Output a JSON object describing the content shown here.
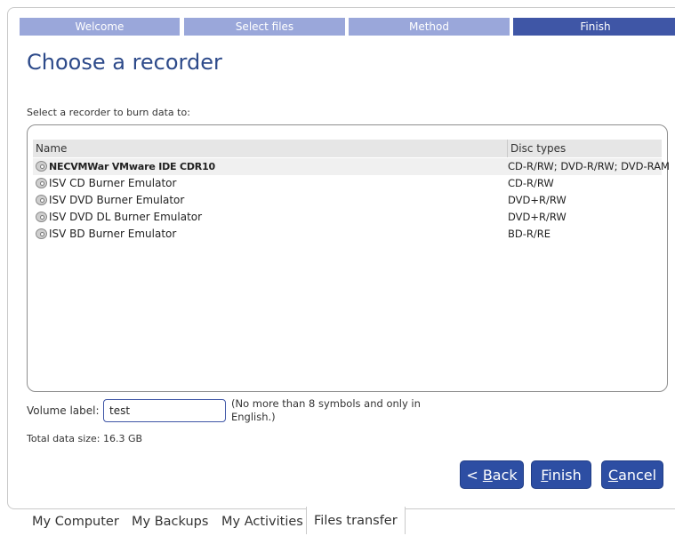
{
  "wizard": {
    "steps": [
      {
        "label": "Welcome"
      },
      {
        "label": "Select files"
      },
      {
        "label": "Method"
      },
      {
        "label": "Finish"
      }
    ],
    "active_step": "Finish",
    "colors": {
      "step_inactive": "#9aa7da",
      "step_active": "#3f56a6",
      "title": "#2d4a8a",
      "button": "#2d4ea3"
    }
  },
  "page": {
    "title": "Choose a recorder",
    "instruction": "Select a recorder to burn data to:"
  },
  "recorders": {
    "columns": {
      "name": "Name",
      "disc_types": "Disc types"
    },
    "rows": [
      {
        "name": "NECVMWar VMware IDE CDR10",
        "disc_types": "CD-R/RW; DVD-R/RW; DVD-RAM",
        "selected": true,
        "icon": "disc-drive-icon"
      },
      {
        "name": "ISV CD Burner Emulator",
        "disc_types": "CD-R/RW",
        "icon": "disc-drive-icon"
      },
      {
        "name": "ISV DVD Burner Emulator",
        "disc_types": "DVD+R/RW",
        "icon": "disc-drive-icon"
      },
      {
        "name": "ISV DVD DL Burner Emulator",
        "disc_types": "DVD+R/RW",
        "icon": "disc-drive-icon"
      },
      {
        "name": "ISV BD Burner Emulator",
        "disc_types": "BD-R/RE",
        "icon": "disc-drive-icon"
      }
    ]
  },
  "volume": {
    "label": "Volume label:",
    "value": "test",
    "note": "(No more than 8 symbols and only in English.)"
  },
  "total": {
    "text": "Total data size: 16.3 GB"
  },
  "buttons": {
    "back": {
      "prefix": "< ",
      "accel": "B",
      "rest": "ack"
    },
    "finish": {
      "accel": "F",
      "rest": "inish"
    },
    "cancel": {
      "accel": "C",
      "rest": "ancel"
    }
  },
  "bottom_tabs": [
    {
      "label": "My Computer"
    },
    {
      "label": "My Backups"
    },
    {
      "label": "My Activities"
    },
    {
      "label": "Files transfer",
      "active": true
    }
  ]
}
